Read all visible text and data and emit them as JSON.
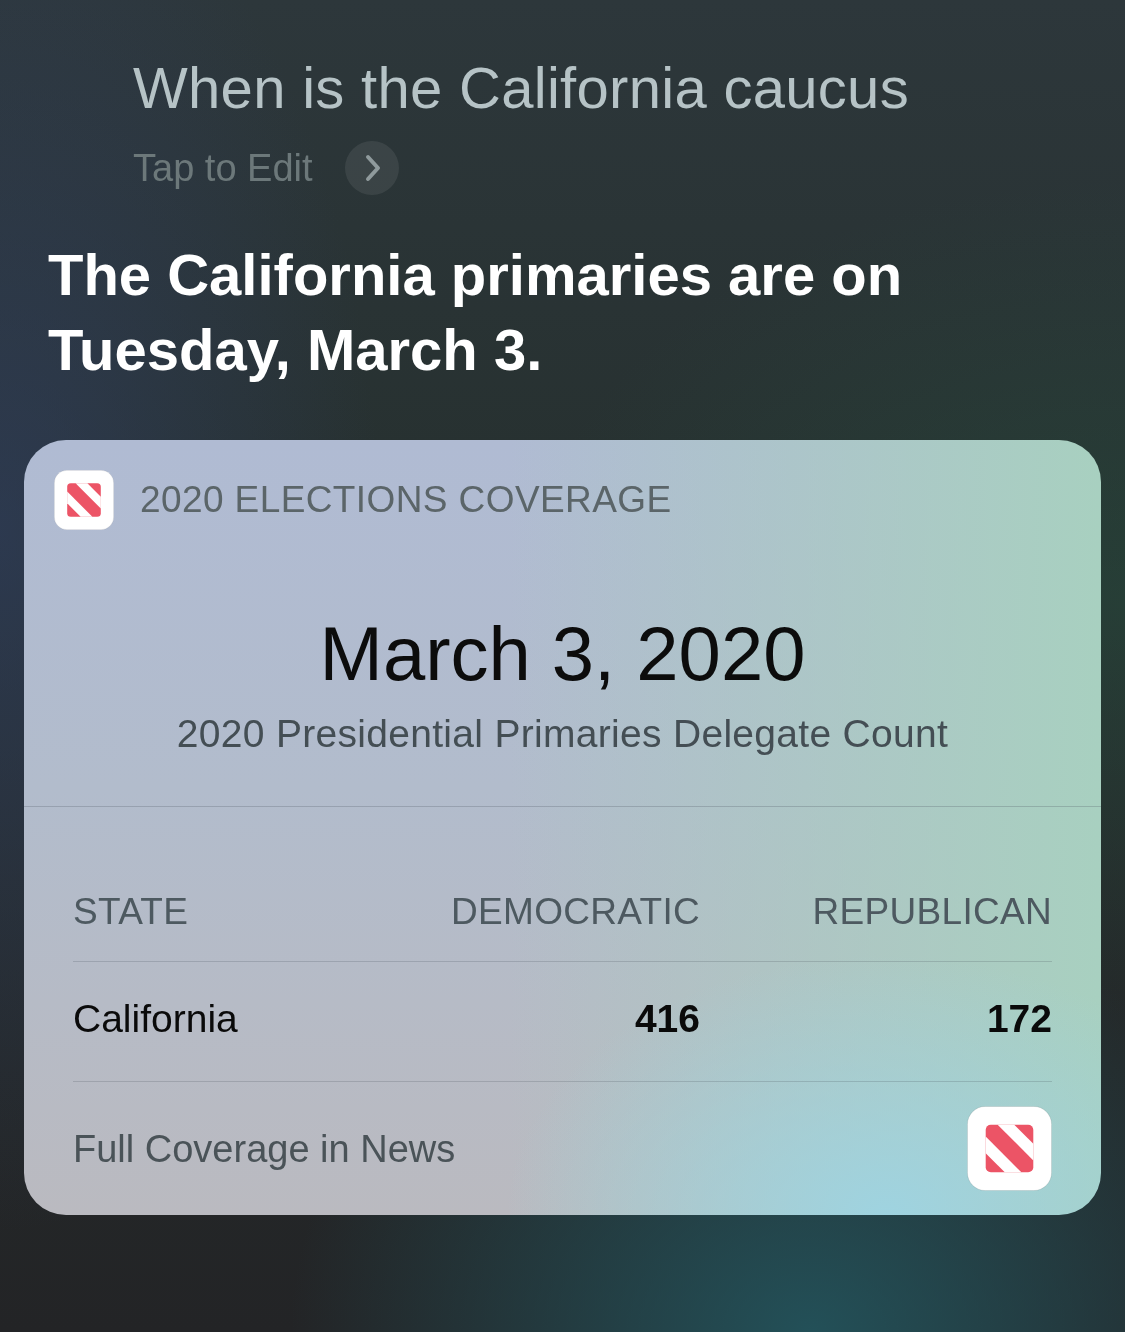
{
  "query": {
    "text": "When is the California caucus",
    "edit_label": "Tap to Edit"
  },
  "answer": "The California primaries are on Tuesday, March 3.",
  "card": {
    "source": "2020 ELECTIONS COVERAGE",
    "date": "March 3, 2020",
    "subtitle": "2020 Presidential Primaries Delegate Count",
    "table": {
      "columns": [
        "STATE",
        "DEMOCRATIC",
        "REPUBLICAN"
      ],
      "rows": [
        [
          "California",
          "416",
          "172"
        ]
      ]
    },
    "footer": "Full Coverage in News"
  }
}
